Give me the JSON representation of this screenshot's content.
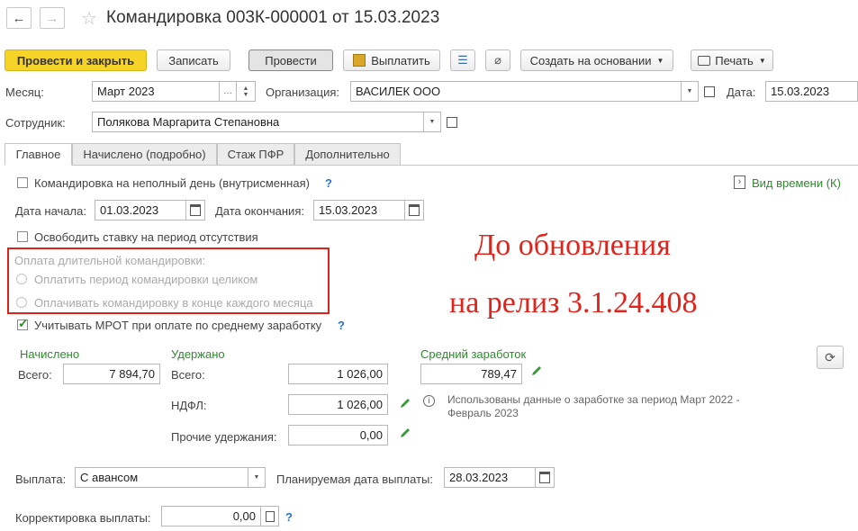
{
  "window": {
    "title": "Командировка 003К-000001 от 15.03.2023"
  },
  "toolbar": {
    "post_close": "Провести и закрыть",
    "save": "Записать",
    "post": "Провести",
    "pay": "Выплатить",
    "create_based": "Создать на основании",
    "print": "Печать"
  },
  "header": {
    "month_label": "Месяц:",
    "month_value": "Март 2023",
    "org_label": "Организация:",
    "org_value": "ВАСИЛЕК ООО",
    "date_label": "Дата:",
    "date_value": "15.03.2023",
    "employee_label": "Сотрудник:",
    "employee_value": "Полякова Маргарита Степановна"
  },
  "tabs": [
    "Главное",
    "Начислено (подробно)",
    "Стаж ПФР",
    "Дополнительно"
  ],
  "main": {
    "partial_day_label": "Командировка на неполный день (внутрисменная)",
    "time_type_link": "Вид времени (К)",
    "start_label": "Дата начала:",
    "start_value": "01.03.2023",
    "end_label": "Дата окончания:",
    "end_value": "15.03.2023",
    "free_rate_label": "Освободить ставку на период отсутствия",
    "long_trip_title": "Оплата длительной командировки:",
    "long_trip_opt1": "Оплатить период командировки целиком",
    "long_trip_opt2": "Оплачивать командировку в конце каждого месяца",
    "mrot_label": "Учитывать МРОТ при оплате по среднему заработку",
    "accrued_title": "Начислено",
    "accrued_total_label": "Всего:",
    "accrued_total_value": "7 894,70",
    "withheld_title": "Удержано",
    "withheld_total_label": "Всего:",
    "withheld_total_value": "1 026,00",
    "ndfl_label": "НДФЛ:",
    "ndfl_value": "1 026,00",
    "other_label": "Прочие удержания:",
    "other_value": "0,00",
    "avg_title": "Средний заработок",
    "avg_value": "789,47",
    "info_text": "Использованы данные о заработке за период Март 2022 - Февраль 2023",
    "payout_label": "Выплата:",
    "payout_value": "С авансом",
    "plan_date_label": "Планируемая дата выплаты:",
    "plan_date_value": "28.03.2023",
    "correction_label": "Корректировка выплаты:",
    "correction_value": "0,00"
  },
  "overlay": {
    "line1": "До обновления",
    "line2": "на релиз 3.1.24.408",
    "color": "#e0241c"
  },
  "colors": {
    "primary_button": "#f5d327",
    "green": "#2e8b2e",
    "help": "#2a72c8"
  }
}
